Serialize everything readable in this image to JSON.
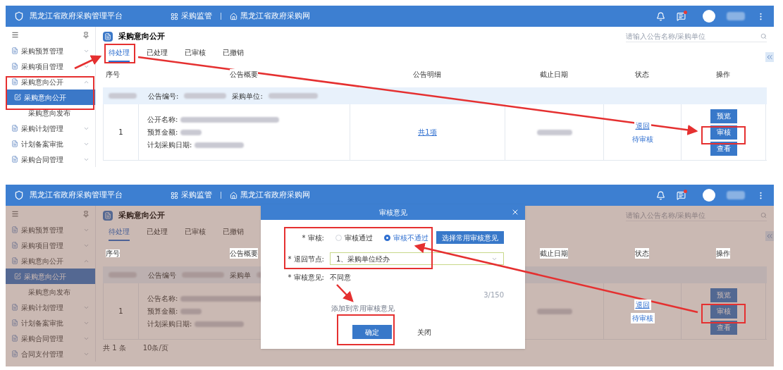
{
  "screens": [
    {
      "header": {
        "title": "黑龙江省政府采购管理平台",
        "nav": [
          "采购监管",
          "黑龙江省政府采购网"
        ],
        "has_notice": true
      },
      "sidebar": {
        "items": [
          {
            "label": "采购预算管理",
            "expanded": false,
            "selected": false
          },
          {
            "label": "采购项目管理",
            "expanded": false,
            "selected": false
          },
          {
            "label": "采购意向公开",
            "expanded": true,
            "selected": false,
            "children": [
              {
                "label": "采购意向公开",
                "selected": true
              },
              {
                "label": "采购意向发布",
                "selected": false
              }
            ]
          },
          {
            "label": "采购计划管理",
            "expanded": false,
            "selected": false
          },
          {
            "label": "计划备案审批",
            "expanded": false,
            "selected": false
          },
          {
            "label": "采购合同管理",
            "expanded": false,
            "selected": false
          }
        ]
      },
      "page_title": "采购意向公开",
      "search": {
        "placeholder": "请输入公告名称/采购单位"
      },
      "tabs": [
        {
          "label": "待处理",
          "selected": true
        },
        {
          "label": "已处理",
          "selected": false
        },
        {
          "label": "已审核",
          "selected": false
        },
        {
          "label": "已撤销",
          "selected": false
        }
      ],
      "table": {
        "columns": [
          "序号",
          "公告概要",
          "公告明细",
          "截止日期",
          "状态",
          "操作"
        ],
        "group": [
          "公告编号:",
          "采购单位:"
        ],
        "rows": [
          {
            "index": "1",
            "fields": [
              "公开名称:",
              "预算金额:",
              "计划采购日期:"
            ],
            "detail_link": "共1项",
            "status": [
              "退回",
              "待审核"
            ],
            "actions": [
              "预览",
              "审核",
              "查看"
            ]
          }
        ]
      }
    },
    {
      "header": {
        "title": "黑龙江省政府采购管理平台",
        "nav": [
          "采购监管",
          "黑龙江省政府采购网"
        ],
        "has_notice": true
      },
      "sidebar": {
        "items": [
          {
            "label": "采购预算管理",
            "expanded": false,
            "selected": false
          },
          {
            "label": "采购项目管理",
            "expanded": false,
            "selected": false
          },
          {
            "label": "采购意向公开",
            "expanded": true,
            "selected": false,
            "children": [
              {
                "label": "采购意向公开",
                "selected": true
              },
              {
                "label": "采购意向发布",
                "selected": false
              }
            ]
          },
          {
            "label": "采购计划管理",
            "expanded": false,
            "selected": false
          },
          {
            "label": "计划备案审批",
            "expanded": false,
            "selected": false
          },
          {
            "label": "采购合同管理",
            "expanded": false,
            "selected": false
          },
          {
            "label": "合同支付管理",
            "expanded": false,
            "selected": false
          }
        ]
      },
      "page_title": "采购意向公开",
      "search": {
        "placeholder": "请输入公告名称/采购单位"
      },
      "tabs": [
        {
          "label": "待处理",
          "selected": true
        },
        {
          "label": "已处理",
          "selected": false
        },
        {
          "label": "已审核",
          "selected": false
        },
        {
          "label": "已撤销",
          "selected": false
        }
      ],
      "table": {
        "columns": [
          "序号",
          "公告概要",
          null,
          "截止日期",
          "状态",
          "操作"
        ],
        "group": [
          "公告编号",
          "采购单"
        ],
        "rows": [
          {
            "index": "1",
            "fields": [
              "公告名称:",
              "预算金额:",
              "计划采购日期:"
            ],
            "status": [
              "退回",
              "待审核"
            ],
            "actions": [
              "预览",
              "审核",
              "查看"
            ]
          }
        ]
      },
      "pagination": {
        "total": "共 1 条",
        "page_size": "10条/页"
      },
      "dialog": {
        "title": "审核意见",
        "audit_label": "* 审核:",
        "options": [
          {
            "label": "审核通过",
            "selected": false
          },
          {
            "label": "审核不通过",
            "selected": true
          }
        ],
        "common_button": "选择常用审核意见",
        "node_label": "* 退回节点:",
        "node_value": "1、采购单位经办",
        "opinion_label": "* 审核意见:",
        "opinion_value": "不同意",
        "counter": "3/150",
        "add_link": "添加到常用审核意见",
        "confirm": "确定",
        "close": "关闭"
      }
    }
  ]
}
